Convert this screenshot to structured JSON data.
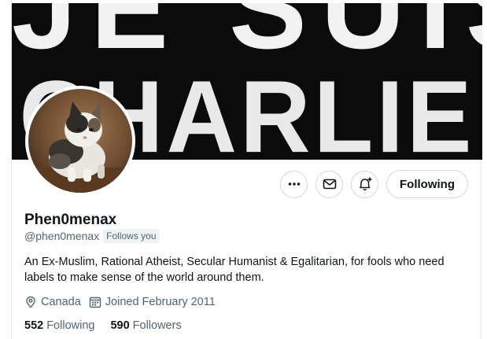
{
  "banner": {
    "line1": "JE SUIS",
    "line2": "CHARLIE"
  },
  "profile": {
    "display_name": "Phen0menax",
    "handle": "@phen0menax",
    "follows_you": "Follows you",
    "bio": "An Ex-Muslim, Rational Atheist, Secular Humanist & Egalitarian, for fools who need labels to make sense of the world around them.",
    "location": "Canada",
    "joined": "Joined February 2011"
  },
  "actions": {
    "more_icon": "more-dots-icon",
    "message_icon": "mail-icon",
    "notify_icon": "bell-plus-icon",
    "follow_label": "Following"
  },
  "stats": {
    "following_count": "552",
    "following_label": "Following",
    "followers_count": "590",
    "followers_label": "Followers"
  },
  "colors": {
    "text_primary": "#0f1419",
    "text_secondary": "#536471",
    "border": "#cfd9de",
    "banner_bg": "#0b0b0b"
  }
}
